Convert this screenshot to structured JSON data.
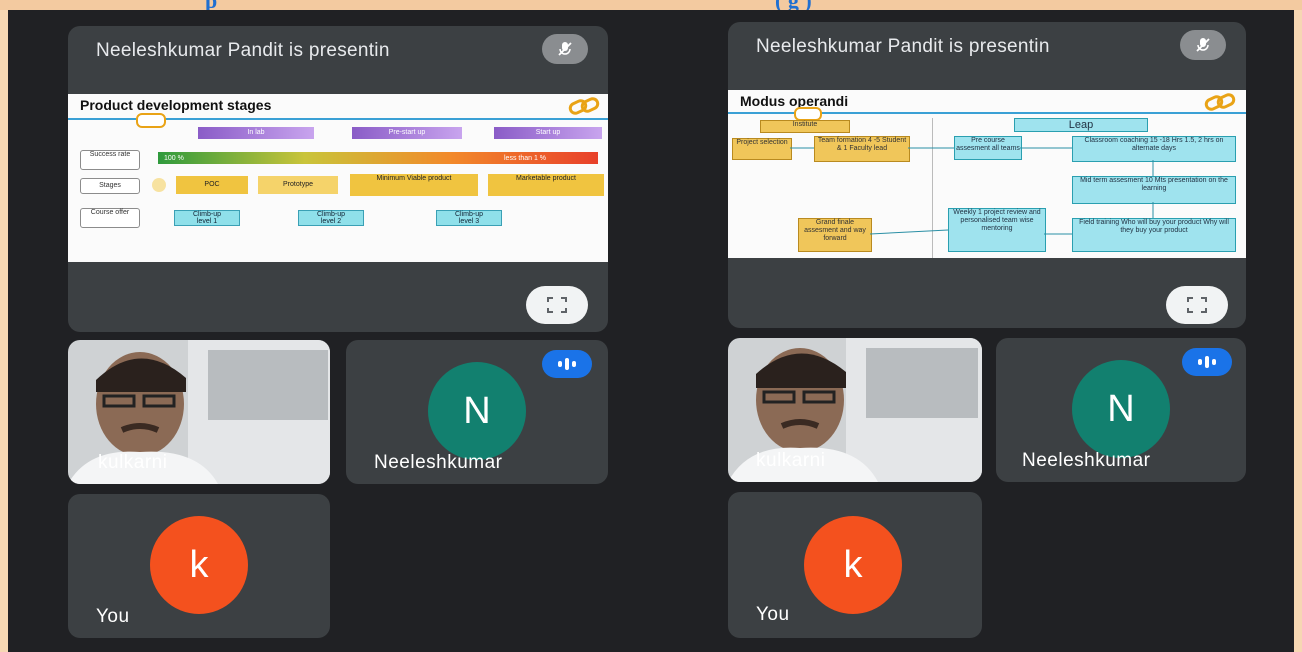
{
  "header": {
    "left_fragment": "p",
    "right_fragment": "(            g       )"
  },
  "screens": [
    {
      "presenting_text": "Neeleshkumar Pandit is presentin",
      "slide": {
        "title": "Product development stages",
        "phases": [
          "In lab",
          "Pre-start up",
          "Start up"
        ],
        "success_label": "Success rate",
        "success_left": "100 %",
        "success_right": "less than 1 %",
        "stages_label": "Stages",
        "stages": [
          "POC",
          "Prototype",
          "Minimum Viable product",
          "Marketable product"
        ],
        "course_label": "Course offer",
        "climbs": [
          {
            "title": "Climb-up",
            "sub": "level 1"
          },
          {
            "title": "Climb-up",
            "sub": "level 2"
          },
          {
            "title": "Climb-up",
            "sub": "level 3"
          }
        ]
      },
      "participants": [
        {
          "name": "kulkarni",
          "type": "camera"
        },
        {
          "name": "Neeleshkumar",
          "initial": "N",
          "color": "#12806f",
          "speaking": true
        },
        {
          "name": "You",
          "initial": "k",
          "color": "#f4511e"
        }
      ]
    },
    {
      "presenting_text": "Neeleshkumar Pandit is presentin",
      "slide": {
        "title": "Modus operandi",
        "institute": "Institute",
        "leap": "Leap",
        "project_selection": "Project selection",
        "team_formation": "Team formation 4 -5 Student & 1 Faculty lead",
        "pre_course": "Pre course assesment all teams",
        "classroom": "Classroom coaching 15 -18 Hrs 1.5, 2 hrs on alternate days",
        "midterm": "Mid term assesment 10 Mts presentation on the learning",
        "field": "Field training Who will buy your product Why will they buy your product",
        "weekly": "Weekly 1 project review and personalised team wise mentoring",
        "grand": "Grand finale assesment and way forward"
      },
      "participants": [
        {
          "name": "kulkarni",
          "type": "camera"
        },
        {
          "name": "Neeleshkumar",
          "initial": "N",
          "color": "#12806f",
          "speaking": true
        },
        {
          "name": "You",
          "initial": "k",
          "color": "#f4511e"
        }
      ]
    }
  ],
  "icons": {
    "mic_off": "mic-off-icon",
    "fullscreen": "fullscreen-icon",
    "speaking": "audio-level-icon",
    "link": "link-icon"
  },
  "colors": {
    "bg": "#202124",
    "tile": "#3c4043",
    "accent": "#1a73e8",
    "frame": "#f6d7b3"
  }
}
